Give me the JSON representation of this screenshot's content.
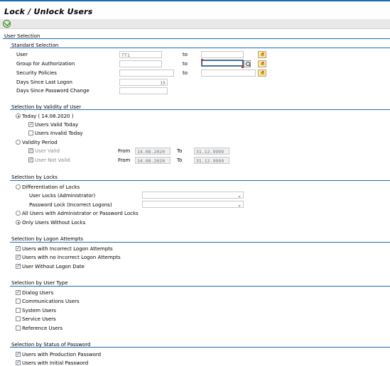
{
  "title": "Lock / Unlock Users",
  "toolbar": {
    "execute_icon": "execute-icon"
  },
  "user_selection": {
    "heading": "User Selection",
    "standard": {
      "heading": "Standard Selection",
      "user_label": "User",
      "user_value": "TT1",
      "group_label": "Group for Authorization",
      "security_label": "Security Policies",
      "days_logon_label": "Days Since Last Logon",
      "days_logon_value": "15",
      "days_pwd_label": "Days Since Password Change",
      "to_label": "to"
    },
    "validity": {
      "heading": "Selection by Validity of User",
      "today_label": "Today ( 14.08.2020 )",
      "valid_today_label": "Users Valid Today",
      "invalid_today_label": "Users Invalid Today",
      "period_label": "Validity Period",
      "user_valid_label": "User Valid",
      "user_not_valid_label": "User Not Valid",
      "from_label": "From",
      "to_label": "To",
      "valid_from": "14.08.2020",
      "valid_to": "31.12.9999",
      "notvalid_from": "14.08.2020",
      "notvalid_to": "31.12.9999"
    },
    "locks": {
      "heading": "Selection by Locks",
      "diff_label": "Differentiation of Locks",
      "admin_lock_label": "User Locks (Administrator)",
      "pwd_lock_label": "Password Lock (Incorrect Logons)",
      "all_users_label": "All Users with Administrator or Password Locks",
      "only_without_label": "Only Users Without Locks"
    },
    "logon_attempts": {
      "heading": "Selection by Logon Attempts",
      "incorrect_label": "Users with Incorrect Logon Attempts",
      "no_incorrect_label": "Users with no Incorrect Logon Attempts",
      "no_date_label": "User Without Logon Date"
    },
    "user_type": {
      "heading": "Selection by User Type",
      "dialog_label": "Dialog Users",
      "comm_label": "Communications Users",
      "system_label": "System Users",
      "service_label": "Service Users",
      "reference_label": "Reference Users"
    },
    "password_status": {
      "heading": "Selection by Status of Password",
      "production_label": "Users with Production Password",
      "initial_label": "Users with Initial Password"
    }
  },
  "colors": {
    "accent": "#1d6bb8",
    "check": "#1d4f8a"
  }
}
